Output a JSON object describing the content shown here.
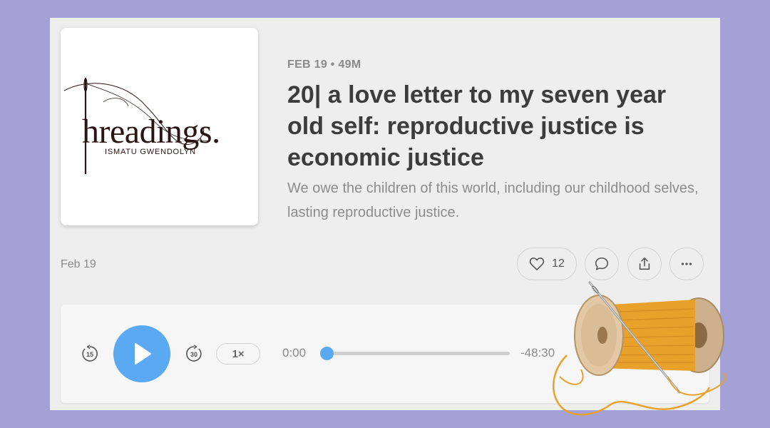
{
  "cover": {
    "title": "hreadings.",
    "subtitle": "ISMATU GWENDOLYN"
  },
  "episode": {
    "meta": "FEB 19 • 49M",
    "title": "20| a love letter to my seven year old self: reproductive justice is economic justice",
    "description": "We owe the children of this world, including our childhood selves, lasting reproductive justice.",
    "date": "Feb 19"
  },
  "actions": {
    "like_count": "12",
    "icons": [
      "heart-icon",
      "comment-icon",
      "share-icon",
      "more-icon"
    ]
  },
  "player": {
    "skip_back": "15",
    "skip_forward": "30",
    "speed": "1×",
    "current_time": "0:00",
    "remaining_time": "-48:30",
    "progress": 0.0
  },
  "colors": {
    "background": "#a3a1d6",
    "card": "#eeeeee",
    "accent": "#5aa9f2",
    "thread": "#e8a22b"
  }
}
